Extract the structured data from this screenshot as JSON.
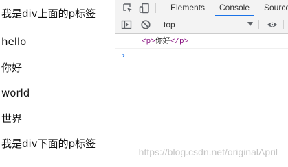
{
  "page": {
    "lines": [
      "我是div上面的p标签",
      "hello",
      "你好",
      "world",
      "世界",
      "我是div下面的p标签"
    ]
  },
  "devtools": {
    "tabs": [
      {
        "label": "Elements",
        "active": false
      },
      {
        "label": "Console",
        "active": true
      },
      {
        "label": "Source",
        "active": false
      }
    ],
    "toolbar": {
      "context": "top"
    },
    "console": {
      "log_tag_open": "<p>",
      "log_text": "你好",
      "log_tag_close": "</p>",
      "prompt": "›"
    }
  },
  "watermark": "https://blog.csdn.net/originalApril",
  "colors": {
    "accent": "#1a73e8",
    "tag": "#881280",
    "toolbar_bg": "#f3f3f3"
  },
  "icons": {
    "inspect": "inspect-icon",
    "device": "device-toggle-icon",
    "sidebar": "sidebar-toggle-icon",
    "clear": "clear-console-icon",
    "eye": "eye-icon"
  }
}
